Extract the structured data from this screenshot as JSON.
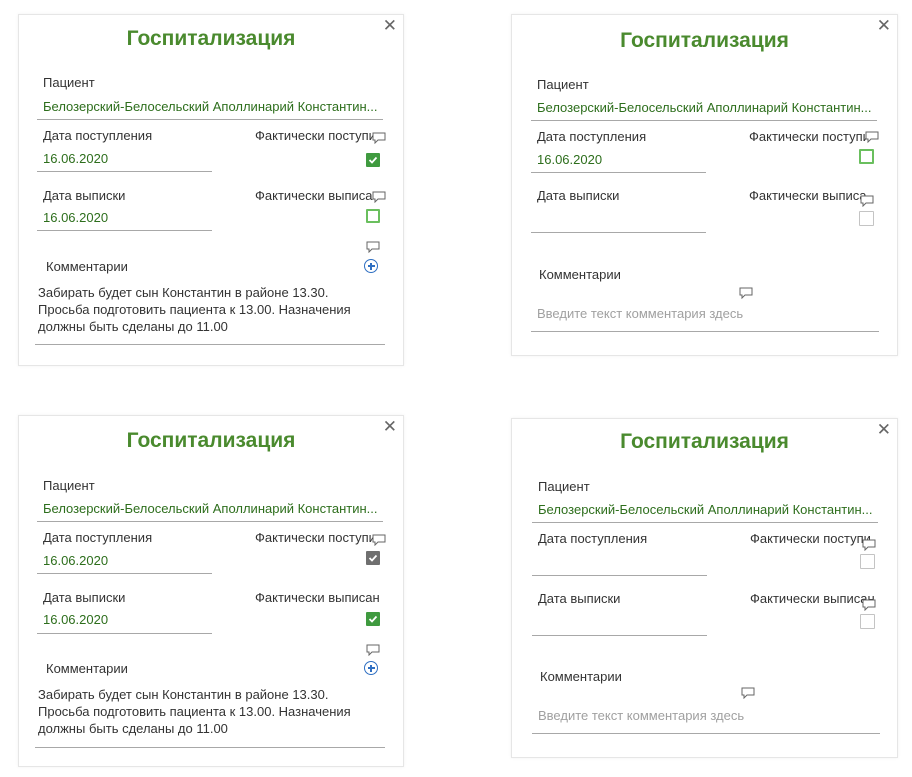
{
  "cards": [
    {
      "title": "Госпитализация",
      "close": "✕",
      "patient_label": "Пациент",
      "patient_name": "Белозерский-Белосельский Аполлинарий Константин...",
      "admission_label": "Дата поступления",
      "admission_date": "16.06.2020",
      "actual_admission_label": "Фактически поступи",
      "actual_admission_checked": true,
      "discharge_label": "Дата выписки",
      "discharge_date": "16.06.2020",
      "actual_discharge_label": "Фактически выписан",
      "actual_discharge_checked": false,
      "comments_label": "Комментарии",
      "comment_lines": [
        "Забирать будет сын Константин в районе 13.30.",
        "Просьба подготовить пациента к 13.00. Назначения",
        "должны быть сделаны до 11.00"
      ]
    },
    {
      "title": "Госпитализация",
      "close": "✕",
      "patient_label": "Пациент",
      "patient_name": "Белозерский-Белосельский Аполлинарий Константин...",
      "admission_label": "Дата поступления",
      "admission_date": "16.06.2020",
      "actual_admission_label": "Фактически поступи",
      "actual_admission_checked": false,
      "discharge_label": "Дата выписки",
      "discharge_date": "",
      "actual_discharge_label": "Фактически выписан",
      "actual_discharge_checked": false,
      "comments_label": "Комментарии",
      "comment_placeholder": "Введите текст комментария здесь"
    },
    {
      "title": "Госпитализация",
      "close": "✕",
      "patient_label": "Пациент",
      "patient_name": "Белозерский-Белосельский Аполлинарий Константин...",
      "admission_label": "Дата поступления",
      "admission_date": "16.06.2020",
      "actual_admission_label": "Фактически поступи",
      "actual_admission_checked": true,
      "discharge_label": "Дата выписки",
      "discharge_date": "16.06.2020",
      "actual_discharge_label": "Фактически выписан",
      "actual_discharge_checked": true,
      "comments_label": "Комментарии",
      "comment_lines": [
        "Забирать будет сын Константин в районе 13.30.",
        "Просьба подготовить пациента к 13.00. Назначения",
        "должны быть сделаны до 11.00"
      ]
    },
    {
      "title": "Госпитализация",
      "close": "✕",
      "patient_label": "Пациент",
      "patient_name": "Белозерский-Белосельский Аполлинарий Константин...",
      "admission_label": "Дата поступления",
      "admission_date": "",
      "actual_admission_label": "Фактически поступи",
      "actual_admission_checked": false,
      "discharge_label": "Дата выписки",
      "discharge_date": "",
      "actual_discharge_label": "Фактически выписан",
      "actual_discharge_checked": false,
      "comments_label": "Комментарии",
      "comment_placeholder": "Введите текст комментария здесь"
    }
  ],
  "colors": {
    "title": "#4a8a2e",
    "value": "#2d6e1c",
    "checked_green": "#3f9a3f",
    "checked_gray": "#6f6f6f",
    "unchecked_green": "#6abf5e",
    "unchecked_gray": "#c4c4c4",
    "add_icon": "#2f6fc2"
  },
  "icons": [
    "close-icon",
    "check-icon",
    "comment-bubble-icon",
    "add-circle-icon"
  ]
}
